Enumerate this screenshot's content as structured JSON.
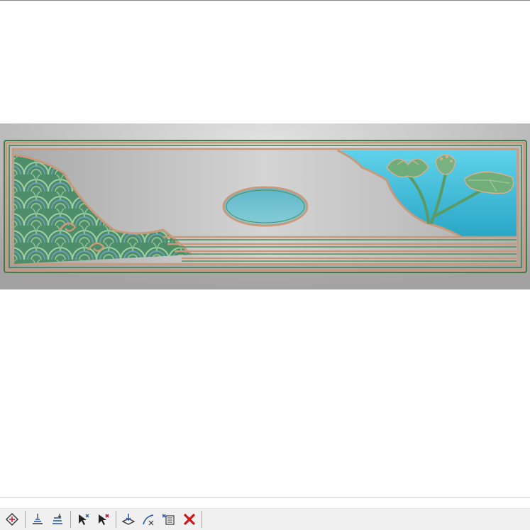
{
  "viewport": {
    "relief": {
      "type": "carved panel",
      "motifs": [
        "wave-pattern",
        "lotus-flower",
        "lotus-seedpod",
        "lotus-leaf",
        "oval-medallion"
      ],
      "colors": {
        "background": "#b9b9b9",
        "frame_green": "#4f8f5c",
        "frame_copper": "#c28e6c",
        "water_cyan": "#4dbfdc",
        "medallion": "#6ec0cf"
      }
    }
  },
  "toolbar": {
    "buttons": [
      {
        "icon": "diamond-node-icon"
      },
      {
        "icon": "align-baseline-icon"
      },
      {
        "icon": "align-layers-icon"
      },
      {
        "icon": "select-arrow-icon"
      },
      {
        "icon": "deselect-arrow-icon"
      },
      {
        "icon": "project-down-icon"
      },
      {
        "icon": "curve-edit-icon"
      },
      {
        "icon": "list-properties-icon"
      },
      {
        "icon": "delete-icon"
      }
    ],
    "colors": {
      "delete": "#d0161b",
      "accent": "#1f50a8"
    }
  }
}
